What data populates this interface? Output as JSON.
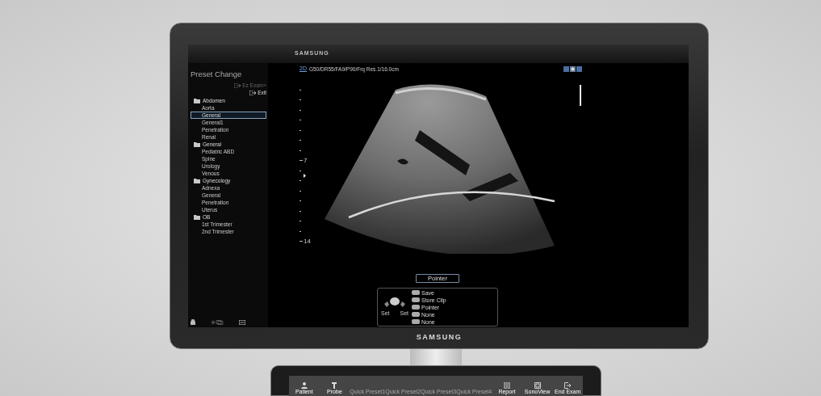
{
  "monitor": {
    "top_bar": {
      "brand": "SAMSUNG"
    },
    "bezel_brand": "SAMSUNG"
  },
  "sidebar": {
    "title": "Preset Change",
    "actions": [
      {
        "label": "Ez Exam+",
        "disabled": true
      },
      {
        "label": "Exit",
        "disabled": false
      }
    ],
    "groups": [
      {
        "label": "Abdomen",
        "children": [
          {
            "label": "Aorta",
            "selected": false
          },
          {
            "label": "General",
            "selected": true
          },
          {
            "label": "General1",
            "selected": false
          },
          {
            "label": "Penetration",
            "selected": false
          },
          {
            "label": "Renal",
            "selected": false
          }
        ]
      },
      {
        "label": "General",
        "children": [
          {
            "label": "Pediatric ABD",
            "selected": false
          },
          {
            "label": "Spine",
            "selected": false
          },
          {
            "label": "Urology",
            "selected": false
          },
          {
            "label": "Venous",
            "selected": false
          }
        ]
      },
      {
        "label": "Gynecology",
        "children": [
          {
            "label": "Adnexa",
            "selected": false
          },
          {
            "label": "General",
            "selected": false
          },
          {
            "label": "Penetration",
            "selected": false
          },
          {
            "label": "Uterus",
            "selected": false
          }
        ]
      },
      {
        "label": "OB",
        "children": [
          {
            "label": "1st Trimester",
            "selected": false
          },
          {
            "label": "2nd Trimester",
            "selected": false
          }
        ]
      }
    ]
  },
  "image": {
    "mode": "2D",
    "parameters": "G50/DR55/FA9/P90/Frq Res.1/16.0cm",
    "depth_labels": [
      "7",
      "14"
    ],
    "pointer_label": "Pointer"
  },
  "trackball": {
    "set_labels": [
      "Set",
      "Set"
    ],
    "keys": [
      "Save",
      "Store Clip",
      "Pointer",
      "None",
      "None"
    ]
  },
  "touch_panel": {
    "buttons": [
      {
        "label": "Patient",
        "kind": "icon",
        "disabled": false
      },
      {
        "label": "Probe",
        "kind": "icon",
        "disabled": false
      },
      {
        "label": "Quick Preset1",
        "kind": "text",
        "disabled": true
      },
      {
        "label": "Quick Preset2",
        "kind": "text",
        "disabled": true
      },
      {
        "label": "Quick Preset3",
        "kind": "text",
        "disabled": true
      },
      {
        "label": "Quick Preset4",
        "kind": "text",
        "disabled": true
      },
      {
        "label": "Report",
        "kind": "icon",
        "disabled": false
      },
      {
        "label": "SonoView",
        "kind": "icon",
        "disabled": false
      },
      {
        "label": "End Exam",
        "kind": "icon",
        "disabled": false
      }
    ]
  }
}
